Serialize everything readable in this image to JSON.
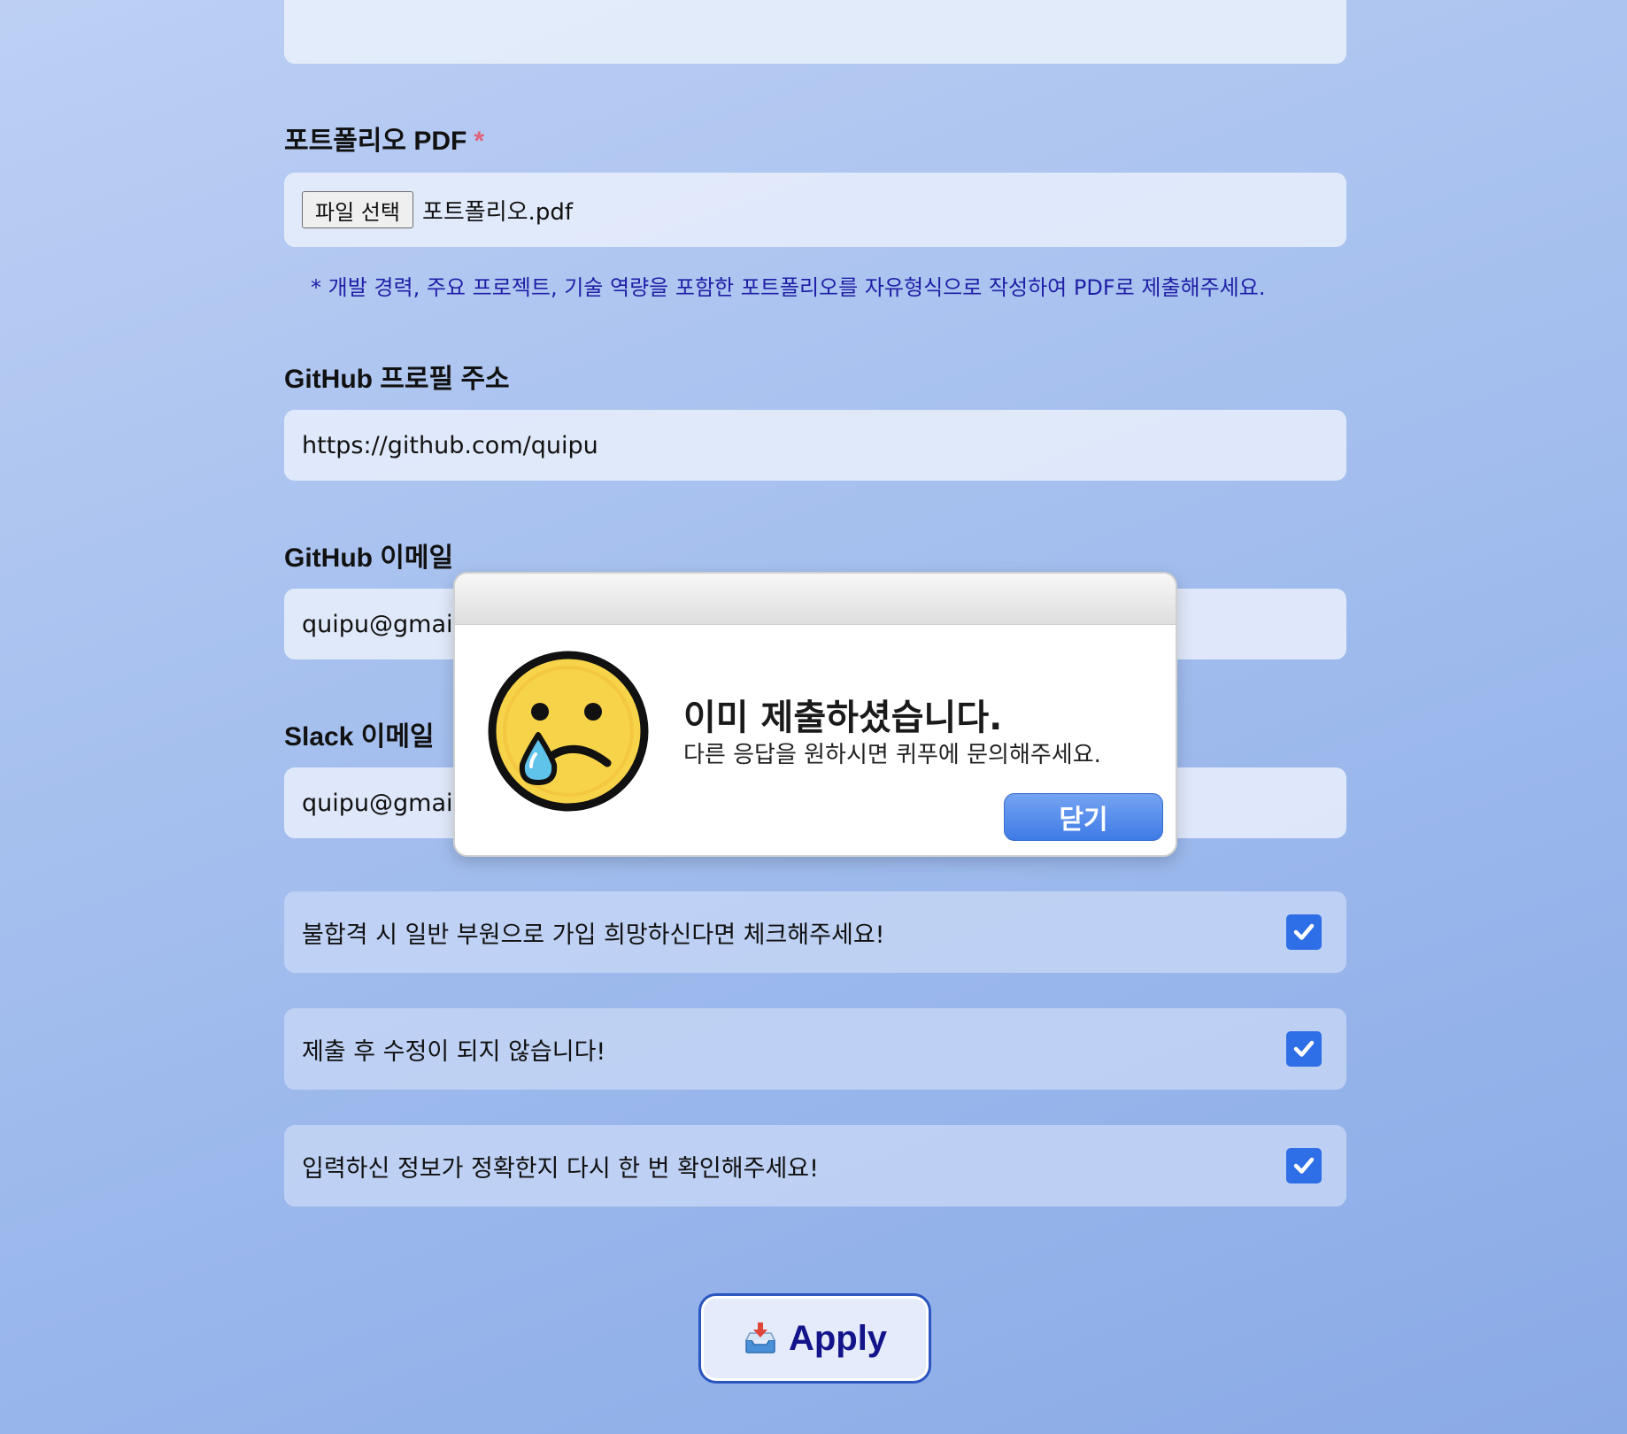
{
  "form": {
    "portfolio": {
      "label": "포트폴리오 PDF",
      "required_mark": "*",
      "file_button": "파일 선택",
      "file_name": "포트폴리오.pdf",
      "note": "* 개발 경력, 주요 프로젝트, 기술 역량을 포함한 포트폴리오를 자유형식으로 작성하여 PDF로 제출해주세요."
    },
    "github_profile": {
      "label": "GitHub 프로필 주소",
      "value": "https://github.com/quipu"
    },
    "github_email": {
      "label": "GitHub 이메일",
      "value": "quipu@gmail."
    },
    "slack_email": {
      "label": "Slack 이메일",
      "value": "quipu@gmail."
    },
    "checks": [
      {
        "label": "불합격 시 일반 부원으로 가입 희망하신다면 체크해주세요!",
        "checked": true
      },
      {
        "label": "제출 후 수정이 되지 않습니다!",
        "checked": true
      },
      {
        "label": "입력하신 정보가 정확한지 다시 한 번 확인해주세요!",
        "checked": true
      }
    ],
    "apply_label": "Apply"
  },
  "dialog": {
    "title": "이미 제출하셨습니다.",
    "message": "다른 응답을 원하시면 퀴푸에 문의해주세요.",
    "close_label": "닫기",
    "icon": "crying-face-icon"
  },
  "colors": {
    "accent": "#2e6ee6",
    "required": "#e0637c",
    "note": "#1f1fa6",
    "apply_text": "#13138a"
  }
}
